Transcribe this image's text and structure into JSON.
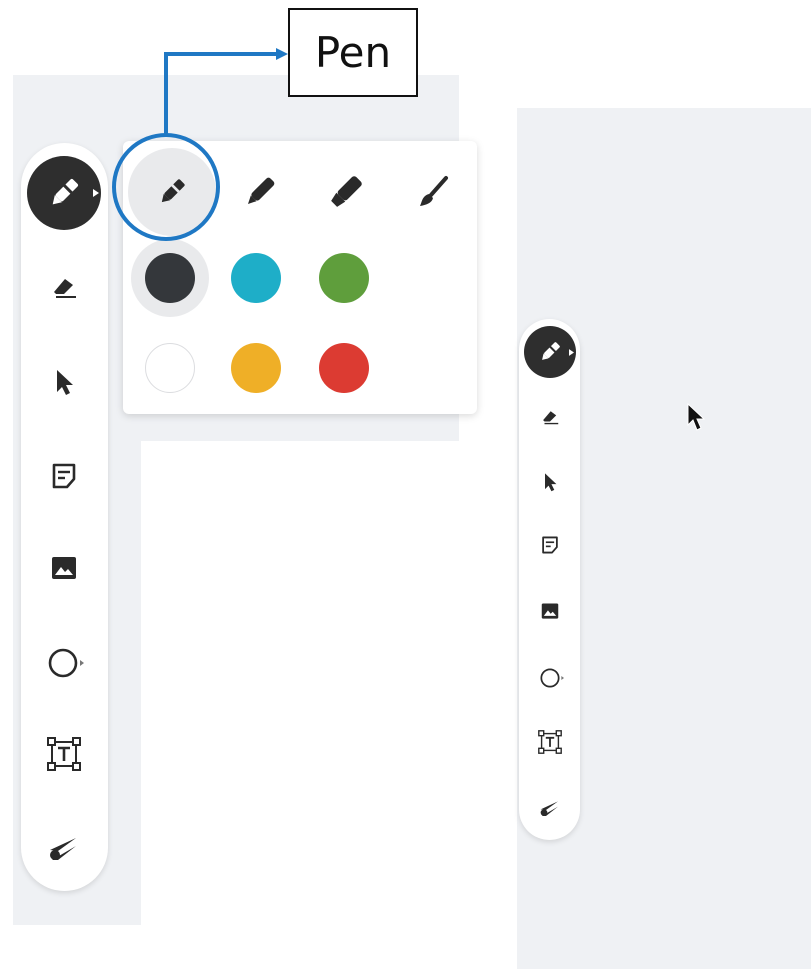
{
  "callout": {
    "label": "Pen"
  },
  "colors": {
    "accent": "#2e2e2e",
    "callout_line": "#1f78c4",
    "canvas": "#eff1f4"
  },
  "toolbar_tools": [
    {
      "name": "pen-tool",
      "icon": "pen-icon",
      "selected": true
    },
    {
      "name": "eraser-tool",
      "icon": "eraser-icon"
    },
    {
      "name": "select-tool",
      "icon": "cursor-icon"
    },
    {
      "name": "sticky-note-tool",
      "icon": "note-icon"
    },
    {
      "name": "image-tool",
      "icon": "image-icon"
    },
    {
      "name": "shape-tool",
      "icon": "circle-icon"
    },
    {
      "name": "text-tool",
      "icon": "text-box-icon"
    },
    {
      "name": "laser-tool",
      "icon": "laser-icon"
    }
  ],
  "pen_types": [
    {
      "name": "pen",
      "icon": "pen-icon",
      "selected": true
    },
    {
      "name": "marker",
      "icon": "marker-icon"
    },
    {
      "name": "highlighter",
      "icon": "highlighter-icon"
    },
    {
      "name": "brush",
      "icon": "brush-icon"
    }
  ],
  "pen_colors": [
    {
      "name": "black",
      "hex": "#34373b",
      "selected": true
    },
    {
      "name": "cyan",
      "hex": "#1eaec8"
    },
    {
      "name": "green",
      "hex": "#5f9e3c"
    },
    {
      "name": "white",
      "hex": "#ffffff"
    },
    {
      "name": "yellow",
      "hex": "#efaf27"
    },
    {
      "name": "red",
      "hex": "#dc3b32"
    }
  ]
}
